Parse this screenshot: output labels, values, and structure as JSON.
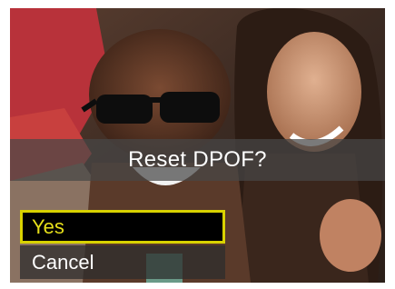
{
  "dialog": {
    "prompt": "Reset DPOF?",
    "options": [
      {
        "label": "Yes",
        "selected": true
      },
      {
        "label": "Cancel",
        "selected": false
      }
    ]
  },
  "colors": {
    "highlight_border": "#d9d200",
    "highlight_text": "#e6df1a",
    "prompt_bar": "#464646"
  }
}
